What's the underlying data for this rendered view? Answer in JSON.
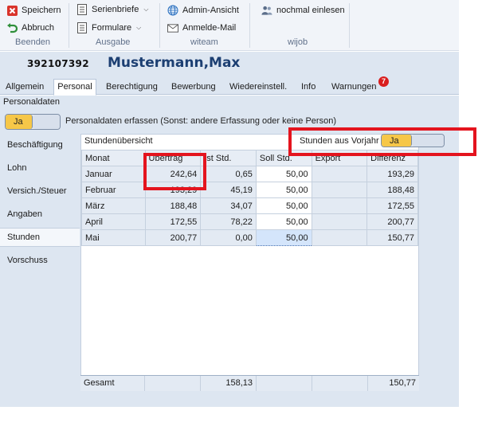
{
  "ribbon": {
    "save": "Speichern",
    "cancel": "Abbruch",
    "group_end": "Beenden",
    "serial_letters": "Serienbriefe",
    "forms": "Formulare",
    "group_output": "Ausgabe",
    "admin_view": "Admin-Ansicht",
    "login_mail": "Anmelde-Mail",
    "group_witeam": "witeam",
    "reload": "nochmal einlesen",
    "group_wijob": "wijob"
  },
  "person": {
    "id": "392107392",
    "name": "Mustermann,Max"
  },
  "tabs": [
    {
      "label": "Allgemein"
    },
    {
      "label": "Personal"
    },
    {
      "label": "Berechtigung"
    },
    {
      "label": "Bewerbung"
    },
    {
      "label": "Wiedereinstell."
    },
    {
      "label": "Info"
    },
    {
      "label": "Warnungen"
    }
  ],
  "warnings_count": "7",
  "section": {
    "title": "Personaldaten",
    "toggle_value": "Ja",
    "toggle_text": "Personaldaten erfassen (Sonst: andere Erfassung oder keine Person)"
  },
  "nav": [
    {
      "label": "Beschäftigung"
    },
    {
      "label": "Lohn"
    },
    {
      "label": "Versich./Steuer"
    },
    {
      "label": "Angaben"
    },
    {
      "label": "Stunden"
    },
    {
      "label": "Vorschuss"
    }
  ],
  "panel": {
    "title": "Stundenübersicht",
    "prev_year_label": "Stunden aus Vorjahr",
    "prev_year_value": "Ja"
  },
  "table": {
    "headers": [
      "Monat",
      "Übertrag",
      "Ist Std.",
      "Soll Std.",
      "Export",
      "Differenz"
    ],
    "rows": [
      [
        "Januar",
        "242,64",
        "0,65",
        "50,00",
        "",
        "193,29"
      ],
      [
        "Februar",
        "193,29",
        "45,19",
        "50,00",
        "",
        "188,48"
      ],
      [
        "März",
        "188,48",
        "34,07",
        "50,00",
        "",
        "172,55"
      ],
      [
        "April",
        "172,55",
        "78,22",
        "50,00",
        "",
        "200,77"
      ],
      [
        "Mai",
        "200,77",
        "0,00",
        "50,00",
        "",
        "150,77"
      ]
    ],
    "footer": [
      "Gesamt",
      "",
      "158,13",
      "",
      "",
      "150,77"
    ]
  },
  "colors": {
    "annotation": "#e4141e",
    "toggle_on": "#f6c748",
    "title_blue": "#1c3f72"
  }
}
